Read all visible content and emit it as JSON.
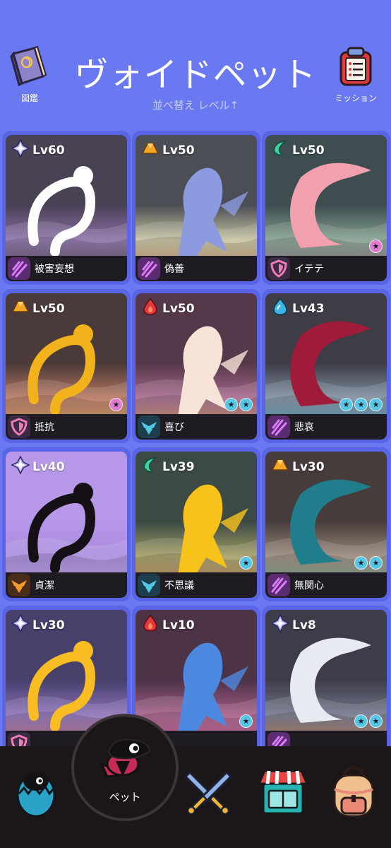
{
  "header": {
    "title": "ヴォイドペット",
    "sort_label": "並べ替え レベル↑",
    "zukan_label": "図鑑",
    "mission_label": "ミッション"
  },
  "pets": [
    {
      "level": "Lv60",
      "name": "被害妄想",
      "element": "void",
      "type": "claw",
      "stars": 0,
      "bg": [
        "#494154",
        "#8a6fa6",
        "#3c3344"
      ],
      "color": "#ffffff"
    },
    {
      "level": "Lv50",
      "name": "偽善",
      "element": "earth",
      "type": "claw",
      "stars": 0,
      "bg": [
        "#4b4e55",
        "#c7c3a0",
        "#d38a55"
      ],
      "color": "#8c9be0"
    },
    {
      "level": "Lv50",
      "name": "イテテ",
      "element": "wind",
      "type": "shield",
      "stars": 1,
      "bg": [
        "#3e4d50",
        "#83a08e",
        "#8c6a7f"
      ],
      "color": "#f2a0ad"
    },
    {
      "level": "Lv50",
      "name": "抵抗",
      "element": "earth",
      "type": "shield",
      "stars": 1,
      "bg": [
        "#4a3a3a",
        "#b7765e",
        "#e4a74b"
      ],
      "color": "#f2b21b"
    },
    {
      "level": "Lv50",
      "name": "喜び",
      "element": "fire",
      "type": "wing",
      "stars": 2,
      "bg": [
        "#55394a",
        "#a6678a",
        "#e3a04f"
      ],
      "color": "#f7e4d8"
    },
    {
      "level": "Lv43",
      "name": "悲哀",
      "element": "water",
      "type": "claw",
      "stars": 3,
      "bg": [
        "#3e3c45",
        "#7c8da0",
        "#3a9fc7"
      ],
      "color": "#a01a3a"
    },
    {
      "level": "Lv40",
      "name": "貞潔",
      "element": "void",
      "type": "emblem",
      "stars": 0,
      "bg": [
        "#b797e8",
        "#a889dd",
        "#c2a7f0"
      ],
      "color": "#141016"
    },
    {
      "level": "Lv39",
      "name": "不思議",
      "element": "wind",
      "type": "wing",
      "stars": 1,
      "bg": [
        "#3c4a45",
        "#a39d63",
        "#c87845"
      ],
      "color": "#f7c21a"
    },
    {
      "level": "Lv30",
      "name": "無関心",
      "element": "earth",
      "type": "claw",
      "stars": 2,
      "bg": [
        "#463c3b",
        "#9a8879",
        "#5da98f"
      ],
      "color": "#1f7d8c"
    },
    {
      "level": "Lv30",
      "name": "",
      "element": "void",
      "type": "shield",
      "stars": 0,
      "bg": [
        "#46406a",
        "#8b6fb8",
        "#d36a6a"
      ],
      "color": "#f8bd22"
    },
    {
      "level": "Lv10",
      "name": "",
      "element": "fire",
      "type": "wing",
      "stars": 1,
      "bg": [
        "#4c3346",
        "#a45b86",
        "#dd5296"
      ],
      "color": "#4d88e0"
    },
    {
      "level": "Lv8",
      "name": "",
      "element": "void",
      "type": "claw",
      "stars": 2,
      "bg": [
        "#3d3c49",
        "#717488",
        "#cf7a3a"
      ],
      "color": "#e8eaf2"
    }
  ],
  "nav": {
    "pet_label": "ペット",
    "items": [
      "egg-icon",
      "pet-icon",
      "battle-swords-icon",
      "shop-icon",
      "backpack-icon"
    ]
  },
  "colors": {
    "background": "#6a78f2",
    "card_frame": "#5964e6",
    "nav_bg": "#1b1719"
  }
}
